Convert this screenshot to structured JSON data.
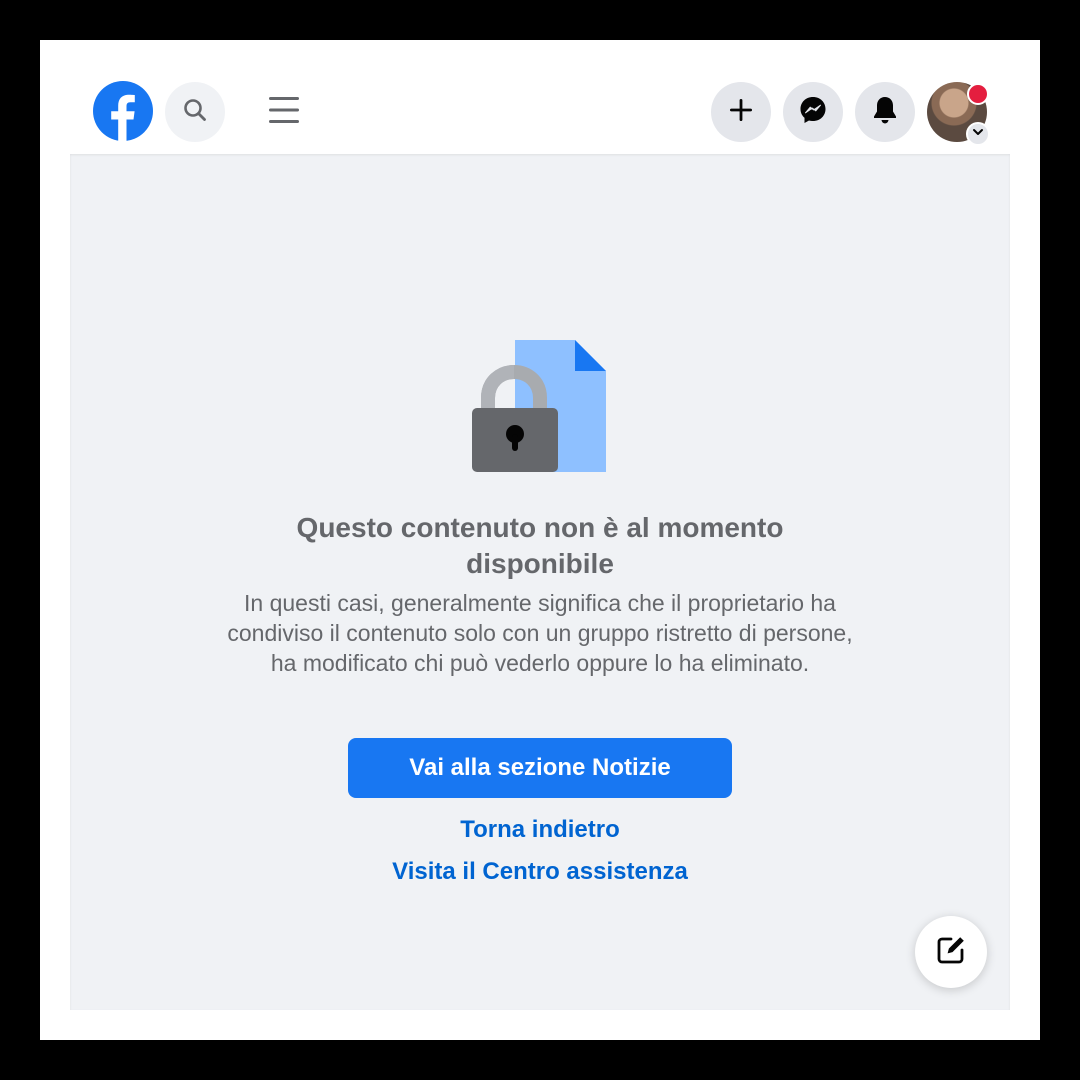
{
  "colors": {
    "brand_blue": "#1877f2",
    "link_blue": "#0064d1",
    "text_gray": "#65676b",
    "icon_button_bg": "#e4e6eb",
    "page_bg": "#f0f2f5",
    "notification_red": "#e41e3f",
    "lock_body": "#65676b",
    "document_blue": "#8ec0ff"
  },
  "header": {
    "icons": {
      "logo": "facebook-logo-icon",
      "search": "search-icon",
      "menu": "hamburger-menu-icon",
      "create": "plus-icon",
      "messenger": "messenger-icon",
      "notifications": "bell-icon",
      "account_chevron": "chevron-down-icon"
    }
  },
  "main": {
    "illustration": "locked-document-icon",
    "title": "Questo contenuto non è al momento disponibile",
    "description": "In questi casi, generalmente significa che il proprietario ha condiviso il contenuto solo con un gruppo ristretto di persone, ha modificato chi può vederlo oppure lo ha eliminato.",
    "primary_button": "Vai alla sezione Notizie",
    "back_link": "Torna indietro",
    "help_link": "Visita il Centro assistenza"
  },
  "floating": {
    "compose_icon": "new-message-icon"
  }
}
